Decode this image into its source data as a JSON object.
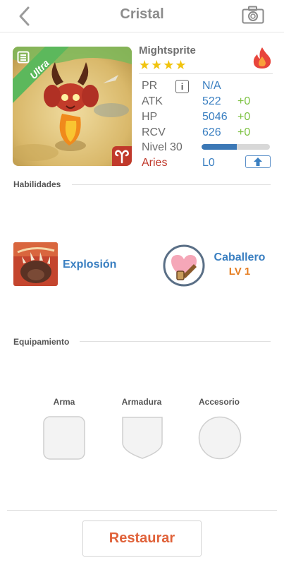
{
  "header": {
    "title": "Cristal",
    "back_icon": "chevron-left-icon",
    "camera_icon": "camera-icon"
  },
  "monster": {
    "name": "Mightsprite",
    "rarity_badge": "Ultra",
    "stars": "★★★★",
    "star_count": 4,
    "element_icon": "fire-icon",
    "sign_icon": "aries-icon"
  },
  "stats": {
    "pr_label": "PR",
    "pr_value": "N/A",
    "atk_label": "ATK",
    "atk_value": "522",
    "atk_bonus": "+0",
    "hp_label": "HP",
    "hp_value": "5046",
    "hp_bonus": "+0",
    "rcv_label": "RCV",
    "rcv_value": "626",
    "rcv_bonus": "+0",
    "level_label": "Nivel 30",
    "level_progress": 0.52,
    "sign_label": "Aries",
    "sign_level": "L0"
  },
  "skills": {
    "section_title": "Habilidades",
    "active_name": "Explosión",
    "leader_name": "Caballero",
    "leader_level": "LV 1"
  },
  "equipment": {
    "section_title": "Equipamiento",
    "weapon_label": "Arma",
    "armor_label": "Armadura",
    "accessory_label": "Accesorio"
  },
  "actions": {
    "restore_label": "Restaurar"
  },
  "colors": {
    "accent_blue": "#3a7fc1",
    "bonus_green": "#7dc242",
    "aries_red": "#c0392b",
    "restore_orange": "#e0623a",
    "leader_orange": "#e67e22",
    "star_yellow": "#f1c40f",
    "ultra_green": "#5cb85c"
  }
}
